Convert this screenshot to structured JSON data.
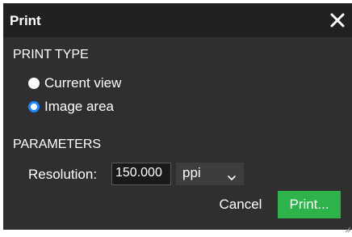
{
  "dialog": {
    "title": "Print",
    "close_icon": "close-icon"
  },
  "print_type": {
    "heading": "PRINT TYPE",
    "options": [
      {
        "label": "Current view",
        "selected": false
      },
      {
        "label": "Image area",
        "selected": true
      }
    ]
  },
  "parameters": {
    "heading": "PARAMETERS",
    "resolution_label": "Resolution:",
    "resolution_value": "150.000",
    "unit": "ppi"
  },
  "buttons": {
    "cancel": "Cancel",
    "print": "Print..."
  },
  "colors": {
    "dialog_bg": "#2f2f2f",
    "titlebar_bg": "#212121",
    "accent_radio": "#1e88ff",
    "print_button": "#2db34a"
  }
}
